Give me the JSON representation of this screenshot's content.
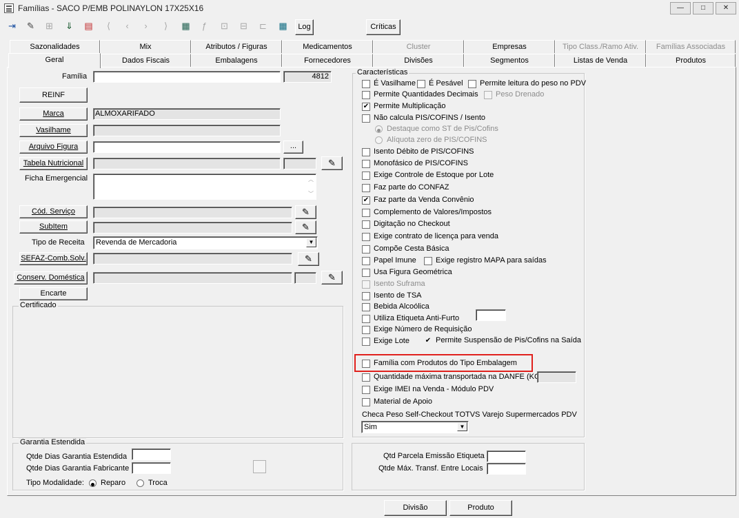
{
  "window": {
    "title": "Famílias - SACO P/EMB POLINAYLON 17X25X16",
    "minimize": "—",
    "maximize": "□",
    "close": "✕"
  },
  "toolbar": {
    "log_label": "Log",
    "criticas_label": "Críticas"
  },
  "tabs_row1": [
    {
      "label": "Sazonalidades",
      "enabled": true
    },
    {
      "label": "Mix",
      "enabled": true
    },
    {
      "label": "Atributos / Figuras",
      "enabled": true
    },
    {
      "label": "Medicamentos",
      "enabled": true
    },
    {
      "label": "Cluster",
      "enabled": false
    },
    {
      "label": "Empresas",
      "enabled": true
    },
    {
      "label": "Tipo Class./Ramo Ativ.",
      "enabled": false
    },
    {
      "label": "Famílias Associadas",
      "enabled": false
    }
  ],
  "tabs_row2": [
    {
      "label": "Geral",
      "active": true
    },
    {
      "label": "Dados Fiscais"
    },
    {
      "label": "Embalagens"
    },
    {
      "label": "Fornecedores"
    },
    {
      "label": "Divisões"
    },
    {
      "label": "Segmentos"
    },
    {
      "label": "Listas de Venda"
    },
    {
      "label": "Produtos"
    }
  ],
  "left": {
    "familia_label": "Família",
    "familia_value": "",
    "familia_code": "4812",
    "reinf_button": "REINF",
    "marca_button": "Marca",
    "marca_value": "ALMOXARIFADO",
    "vasilhame_button": "Vasilhame",
    "arquivo_figura_button": "Arquivo Figura",
    "browse_button": "...",
    "tabela_nutricional_button": "Tabela Nutricional",
    "ficha_emergencial_label": "Ficha Emergencial",
    "cod_servico_button": "Cód. Serviço",
    "subitem_button": "SubItem",
    "tipo_receita_label": "Tipo de Receita",
    "tipo_receita_value": "Revenda de Mercadoria",
    "sefaz_button": "SEFAZ-Comb.Solv.",
    "conserv_button": "Conserv. Doméstica",
    "encarte_button": "Encarte",
    "certificado_label": "Certificado"
  },
  "garantia": {
    "title": "Garantia Estendida",
    "dias_estendida_label": "Qtde Dias Garantia Estendida",
    "dias_fabricante_label": "Qtde Dias Garantia Fabricante",
    "modalidade_label": "Tipo Modalidade:",
    "reparo_label": "Reparo",
    "troca_label": "Troca",
    "selected": "Reparo"
  },
  "caracteristicas": {
    "title": "Características",
    "e_vasilhame": {
      "label": "É Vasilhame",
      "checked": false
    },
    "e_pesavel": {
      "label": "É Pesável",
      "checked": false
    },
    "permite_leitura_peso": {
      "label": "Permite leitura do peso no PDV",
      "checked": false
    },
    "permite_qtd_decimais": {
      "label": "Permite Quantidades Decimais",
      "checked": false
    },
    "peso_drenado": {
      "label": "Peso Drenado",
      "checked": false
    },
    "permite_multiplicacao": {
      "label": "Permite Multiplicação",
      "checked": true
    },
    "nao_calcula_pis": {
      "label": "Não calcula PIS/COFINS / Isento",
      "checked": false
    },
    "destaque_st": {
      "label": "Destaque como ST de Pis/Cofins",
      "selected": true
    },
    "aliquota_zero": {
      "label": "Alíquota zero de PIS/COFINS",
      "selected": false
    },
    "isento_debito": {
      "label": "Isento Débito de PIS/COFINS",
      "checked": false
    },
    "monofasico": {
      "label": "Monofásico de PIS/COFINS",
      "checked": false
    },
    "exige_controle_lote": {
      "label": "Exige Controle de Estoque por Lote",
      "checked": false
    },
    "faz_parte_confaz": {
      "label": "Faz parte do CONFAZ",
      "checked": false
    },
    "faz_parte_venda_convenio": {
      "label": "Faz parte da Venda Convênio",
      "checked": true
    },
    "complemento_valores": {
      "label": "Complemento de Valores/Impostos",
      "checked": false
    },
    "digitacao_checkout": {
      "label": "Digitação no Checkout",
      "checked": false
    },
    "exige_contrato_licenca": {
      "label": "Exige contrato de licença para venda",
      "checked": false
    },
    "compoe_cesta_basica": {
      "label": "Compõe Cesta Básica",
      "checked": false
    },
    "papel_imune": {
      "label": "Papel Imune",
      "checked": false
    },
    "exige_registro_mapa": {
      "label": "Exige registro MAPA para saídas",
      "checked": false
    },
    "usa_figura_geometrica": {
      "label": "Usa Figura Geométrica",
      "checked": false
    },
    "isento_suframa": {
      "label": "Isento Suframa",
      "checked": false
    },
    "isento_tsa": {
      "label": "Isento de TSA",
      "checked": false
    },
    "bebida_alcoolica": {
      "label": "Bebida Alcoólica",
      "checked": false
    },
    "utiliza_etiqueta": {
      "label": "Utiliza Etiqueta Anti-Furto",
      "checked": false
    },
    "exige_numero_requisicao": {
      "label": "Exige Número de Requisição",
      "checked": false
    },
    "exige_lote": {
      "label": "Exige Lote",
      "checked": false
    },
    "permite_suspensao": {
      "label": "Permite Suspensão de Pis/Cofins na Saída",
      "checked": true
    },
    "familia_produtos_embalagem": {
      "label": "Família com Produtos do Tipo Embalagem",
      "checked": false
    },
    "qtd_max_danfe": {
      "label": "Quantidade máxima transportada na DANFE (KG)",
      "checked": false
    },
    "exige_imei": {
      "label": "Exige IMEI na Venda - Módulo PDV",
      "checked": false
    },
    "material_apoio": {
      "label": "Material de Apoio",
      "checked": false
    },
    "checa_peso_label": "Checa Peso Self-Checkout TOTVS Varejo Supermercados PDV",
    "checa_peso_value": "Sim"
  },
  "bottom_right": {
    "qtd_parcela_label": "Qtd Parcela Emissão Etiqueta",
    "qtd_max_transf_label": "Qtde Máx. Transf. Entre Locais"
  },
  "footer": {
    "divisao_button": "Divisão",
    "produto_button": "Produto"
  },
  "colors": {
    "highlight": "#e0201c",
    "window_bg": "#f0f0f0"
  }
}
